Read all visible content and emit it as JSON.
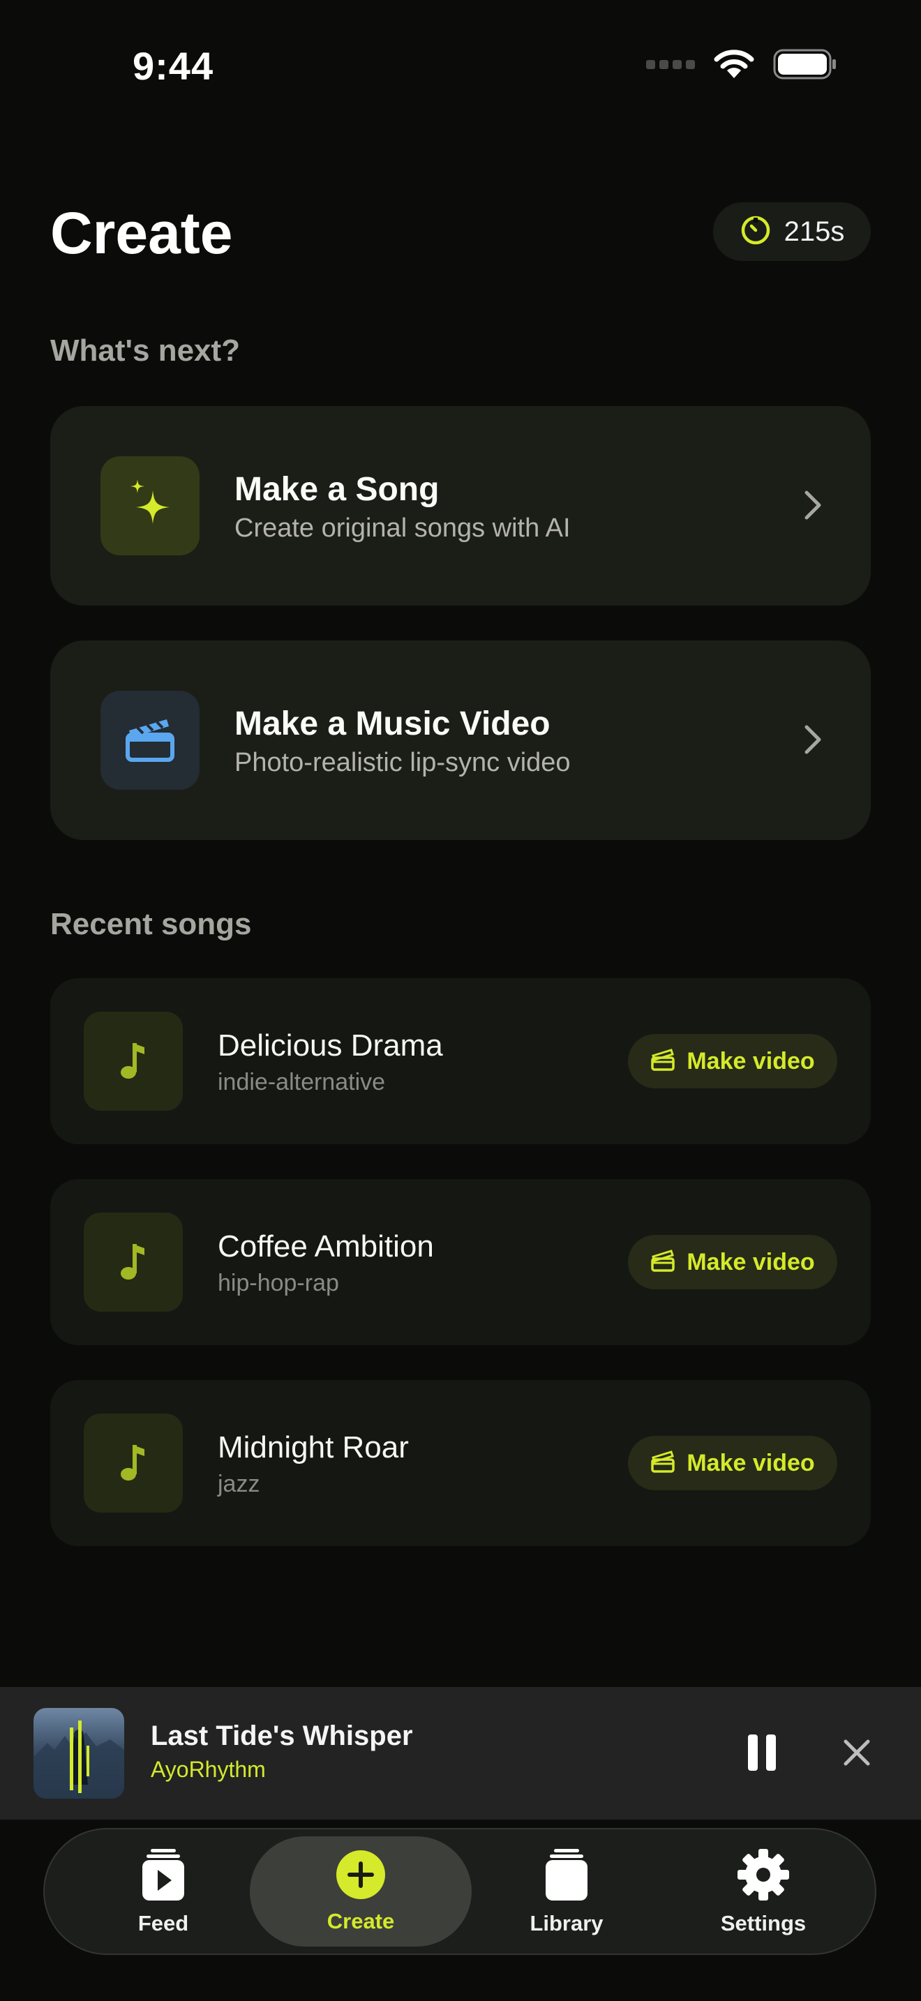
{
  "status_bar": {
    "time": "9:44"
  },
  "header": {
    "title": "Create",
    "credits": "215s"
  },
  "whats_next": {
    "label": "What's next?",
    "cards": [
      {
        "title": "Make a Song",
        "subtitle": "Create original songs with AI"
      },
      {
        "title": "Make a Music Video",
        "subtitle": "Photo-realistic lip-sync video"
      }
    ]
  },
  "recent": {
    "label": "Recent songs",
    "make_video_label": "Make video",
    "songs": [
      {
        "title": "Delicious Drama",
        "genre": "indie-alternative"
      },
      {
        "title": "Coffee Ambition",
        "genre": "hip-hop-rap"
      },
      {
        "title": "Midnight Roar",
        "genre": "jazz"
      }
    ]
  },
  "player": {
    "title": "Last Tide's Whisper",
    "artist": "AyoRhythm"
  },
  "tabs": [
    {
      "label": "Feed",
      "icon": "feed-icon"
    },
    {
      "label": "Create",
      "icon": "plus-circle-icon",
      "active": true
    },
    {
      "label": "Library",
      "icon": "library-icon"
    },
    {
      "label": "Settings",
      "icon": "gear-icon"
    }
  ],
  "colors": {
    "accent": "#d4ea2a",
    "background": "#0b0c0a",
    "card": "#1b1d17",
    "video_icon": "#5aa7f0"
  }
}
